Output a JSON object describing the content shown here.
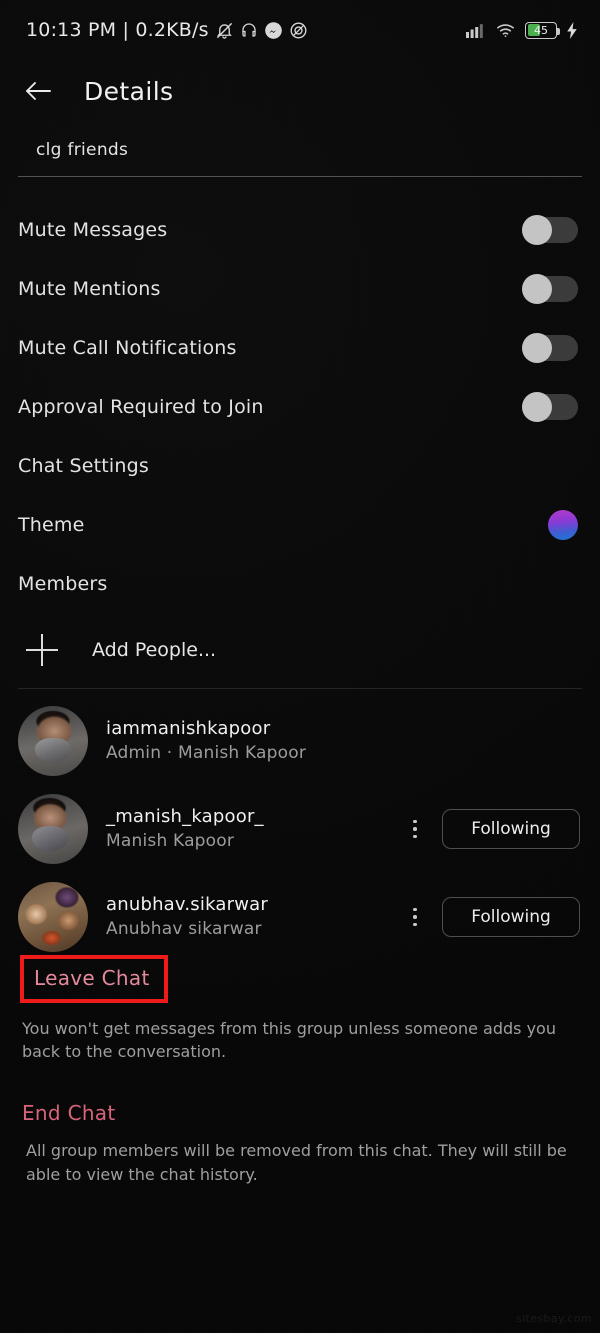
{
  "statusbar": {
    "clock": "10:13 PM | 0.2KB/s",
    "icons": [
      "bell-muted-icon",
      "headphones-icon",
      "messenger-icon",
      "dnd-icon"
    ],
    "signal": "signal-icon",
    "wifi": "wifi-icon",
    "battery_level": "45",
    "charging": "charging-bolt-icon"
  },
  "header": {
    "back": "back-arrow-icon",
    "title": "Details"
  },
  "group": {
    "name": "clg friends"
  },
  "settings": {
    "rows": [
      {
        "label": "Mute Messages",
        "control": "toggle",
        "value": "off"
      },
      {
        "label": "Mute Mentions",
        "control": "toggle",
        "value": "off"
      },
      {
        "label": "Mute Call Notifications",
        "control": "toggle",
        "value": "off"
      },
      {
        "label": "Approval Required to Join",
        "control": "toggle",
        "value": "off"
      },
      {
        "label": "Chat Settings",
        "control": "none",
        "value": ""
      },
      {
        "label": "Theme",
        "control": "color-dot",
        "value": "#8a3ad6"
      },
      {
        "label": "Members",
        "control": "none",
        "value": ""
      }
    ]
  },
  "add_people": {
    "icon": "plus-icon",
    "label": "Add People..."
  },
  "members": [
    {
      "username": "iammanishkapoor",
      "subtitle": "Admin · Manish Kapoor",
      "avatar": "face1",
      "has_menu": false,
      "action_label": ""
    },
    {
      "username": "_manish_kapoor_",
      "subtitle": "Manish Kapoor",
      "avatar": "face2",
      "has_menu": true,
      "action_label": "Following"
    },
    {
      "username": "anubhav.sikarwar",
      "subtitle": "Anubhav sikarwar",
      "avatar": "group",
      "has_menu": true,
      "action_label": "Following"
    }
  ],
  "danger": {
    "leave_title": "Leave Chat",
    "leave_desc": "You won't get messages from this group unless someone adds you back to the conversation.",
    "end_title": "End Chat",
    "end_desc": "All group members will be removed from this chat. They will still be able to view the chat history.",
    "highlight_color": "#ef1a1a"
  },
  "watermark": "sitesbay.com"
}
